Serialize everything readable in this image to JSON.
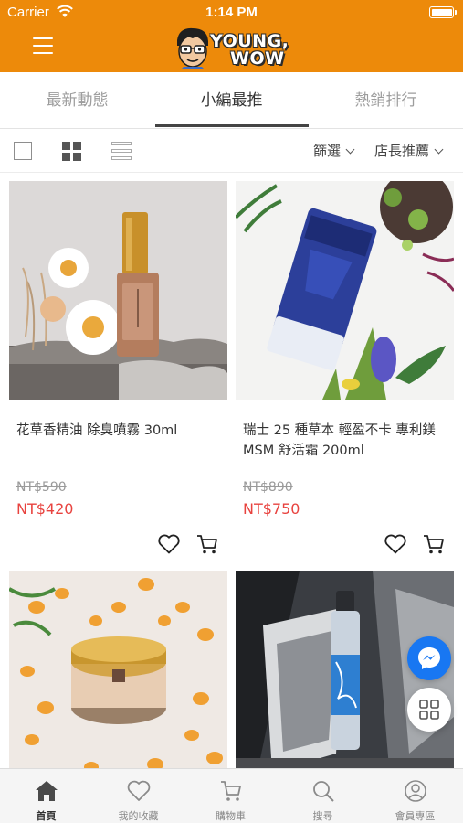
{
  "status_bar": {
    "carrier": "Carrier",
    "time": "1:14 PM"
  },
  "brand": {
    "line1": "YOUNG,",
    "line2": "WOW",
    "accent_color": "#ed8a0a"
  },
  "tabs": [
    {
      "label": "最新動態",
      "active": false
    },
    {
      "label": "小編最推",
      "active": true
    },
    {
      "label": "熱銷排行",
      "active": false
    }
  ],
  "toolbar": {
    "view_modes": [
      "single-view-icon",
      "grid-view-icon",
      "list-view-icon"
    ],
    "filter_label": "篩選",
    "sort_label": "店長推薦"
  },
  "products": [
    {
      "title": "花草香精油 除臭噴霧 30ml",
      "original_price": "NT$590",
      "price": "NT$420"
    },
    {
      "title": "瑞士 25 種草本 輕盈不卡 專利鎂 MSM 舒活霜 200ml",
      "original_price": "NT$890",
      "price": "NT$750"
    },
    {
      "title": "",
      "original_price": "",
      "price": ""
    },
    {
      "title": "",
      "original_price": "",
      "price": ""
    }
  ],
  "bottom_nav": [
    {
      "label": "首頁",
      "icon": "home-icon",
      "active": true
    },
    {
      "label": "我的收藏",
      "icon": "heart-icon",
      "active": false
    },
    {
      "label": "購物車",
      "icon": "cart-icon",
      "active": false
    },
    {
      "label": "搜尋",
      "icon": "search-icon",
      "active": false
    },
    {
      "label": "會員專區",
      "icon": "user-icon",
      "active": false
    }
  ],
  "colors": {
    "price": "#e8433f",
    "messenger": "#1877f2"
  }
}
